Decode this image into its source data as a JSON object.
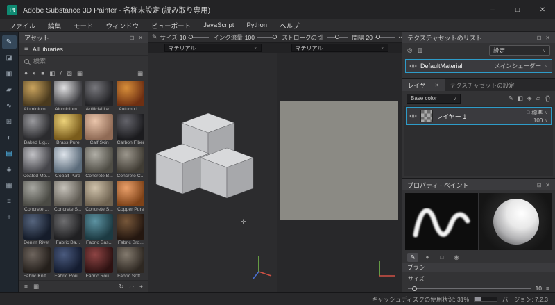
{
  "colors": {
    "accent": "#2e9cc9",
    "app_badge_bg": "#0f8a72"
  },
  "icons": {
    "chevron": "∨",
    "hamburger": "≡",
    "float": "⊡",
    "close": "✕",
    "refresh": "↻",
    "folder": "▱",
    "plus": "+",
    "grid": "▦",
    "columns": "▥",
    "pencil": "✎",
    "sq_outline": "□",
    "target": "◎",
    "cursor": "✛"
  },
  "titlebar": {
    "app_badge": "Pt",
    "title": "Adobe Substance 3D Painter - 名称未設定 (読み取り専用)",
    "minimize": "–",
    "maximize": "□",
    "close": "✕"
  },
  "menubar": {
    "items": [
      "ファイル",
      "編集",
      "モード",
      "ウィンドウ",
      "ビューポート",
      "JavaScript",
      "Python",
      "ヘルプ"
    ]
  },
  "toolbar": {
    "groups": [
      {
        "label": "サイズ",
        "value": "10",
        "pos": "12%"
      },
      {
        "label": "インク流量",
        "value": "100",
        "pos": "86%"
      },
      {
        "label": "ストロークの引",
        "value": "",
        "pos": "50%"
      },
      {
        "label": "間隔",
        "value": "20",
        "pos": "18%"
      }
    ],
    "right_icons": [
      {
        "name": "stroke-dots-icon",
        "glyph": "⋯"
      },
      {
        "name": "pen-settings-icon",
        "glyph": "✎"
      }
    ]
  },
  "toolstrip": {
    "tools": [
      {
        "name": "paint-tool-icon",
        "glyph": "✎",
        "selected": true
      },
      {
        "name": "eraser-tool-icon",
        "glyph": "◪"
      },
      {
        "name": "projection-tool-icon",
        "glyph": "▣"
      },
      {
        "name": "polygon-fill-tool-icon",
        "glyph": "▰"
      },
      {
        "name": "smudge-tool-icon",
        "glyph": "∿"
      },
      {
        "name": "clone-tool-icon",
        "glyph": "⊞"
      },
      {
        "name": "material-picker-tool-icon",
        "glyph": "◐"
      },
      {
        "name": "quick-mask-tool-icon",
        "glyph": "▤",
        "accent": true
      },
      {
        "name": "symmetry-tool-icon",
        "glyph": "◈"
      },
      {
        "name": "grid-tool-icon",
        "glyph": "▦"
      },
      {
        "name": "view-settings-tool-icon",
        "glyph": "≡"
      },
      {
        "name": "add-tool-icon",
        "glyph": "+"
      }
    ]
  },
  "assets": {
    "title": "アセット",
    "library_label": "All libraries",
    "search_placeholder": "検索",
    "filters": [
      {
        "name": "filter-materials-icon",
        "glyph": "●"
      },
      {
        "name": "filter-smart-materials-icon",
        "glyph": "◐"
      },
      {
        "name": "filter-smart-masks-icon",
        "glyph": "■"
      },
      {
        "name": "filter-filters-icon",
        "glyph": "◧"
      },
      {
        "name": "filter-brushes-icon",
        "glyph": "/"
      },
      {
        "name": "filter-alphas-icon",
        "glyph": "▨"
      },
      {
        "name": "filter-textures-icon",
        "glyph": "▦"
      }
    ],
    "footer_left": [
      {
        "name": "list-view-icon",
        "glyph": "≡"
      },
      {
        "name": "thumbnail-view-icon",
        "glyph": "▦"
      }
    ],
    "footer_right": [
      {
        "name": "refresh-assets-icon",
        "glyph": "↻"
      },
      {
        "name": "import-resources-icon",
        "glyph": "▱"
      },
      {
        "name": "add-resource-icon",
        "glyph": "+"
      }
    ],
    "materials": [
      {
        "name": "Aluminium...",
        "c1": "#caa45e",
        "c2": "#4a3a1e"
      },
      {
        "name": "Aluminium...",
        "c1": "#e0e0e2",
        "c2": "#3c3c40"
      },
      {
        "name": "Artificial Le...",
        "c1": "#77777c",
        "c2": "#232326"
      },
      {
        "name": "Autumn L...",
        "c1": "#d88f3a",
        "c2": "#6e2f12"
      },
      {
        "name": "Baked Lig...",
        "c1": "#9a9a9e",
        "c2": "#2b2b2e"
      },
      {
        "name": "Brass Pure",
        "c1": "#ecd27a",
        "c2": "#7a5c1c"
      },
      {
        "name": "Calf Skin",
        "c1": "#eac5ab",
        "c2": "#8f6a55"
      },
      {
        "name": "Carbon Fiber",
        "c1": "#63636a",
        "c2": "#1b1b1e"
      },
      {
        "name": "Coated Me...",
        "c1": "#c2c2c6",
        "c2": "#45454a"
      },
      {
        "name": "Cobalt Pure",
        "c1": "#dde3ea",
        "c2": "#5b6b7a"
      },
      {
        "name": "Concrete B...",
        "c1": "#b0aea6",
        "c2": "#4e4c44"
      },
      {
        "name": "Concrete C...",
        "c1": "#9b968c",
        "c2": "#403c34"
      },
      {
        "name": "Concrete ...",
        "c1": "#a8a8a2",
        "c2": "#4a4a44"
      },
      {
        "name": "Concrete S...",
        "c1": "#c6c2ba",
        "c2": "#5e5a52"
      },
      {
        "name": "Concrete S...",
        "c1": "#cfc2ab",
        "c2": "#6e6250"
      },
      {
        "name": "Copper Pure",
        "c1": "#eba06a",
        "c2": "#7e4218"
      },
      {
        "name": "Denim Rivet",
        "c1": "#56657e",
        "c2": "#151c2a"
      },
      {
        "name": "Fabric Ba...",
        "c1": "#6e6e70",
        "c2": "#202022"
      },
      {
        "name": "Fabric Bas...",
        "c1": "#5d93a2",
        "c2": "#1c3a42"
      },
      {
        "name": "Fabric Bro...",
        "c1": "#77573a",
        "c2": "#241710"
      },
      {
        "name": "Fabric Knit...",
        "c1": "#6e655e",
        "c2": "#241f1b"
      },
      {
        "name": "Fabric Rou...",
        "c1": "#4a5a7e",
        "c2": "#141c30"
      },
      {
        "name": "Fabric Rou...",
        "c1": "#8e4444",
        "c2": "#2e1212"
      },
      {
        "name": "Fabric Soft...",
        "c1": "#837a6e",
        "c2": "#2e2822"
      }
    ]
  },
  "viewport3d": {
    "selector": "マテリアル"
  },
  "viewport2d": {
    "selector": "マテリアル"
  },
  "texture_sets": {
    "title": "テクスチャセットのリスト",
    "settings_label": "設定",
    "set_name": "DefaultMaterial",
    "shader_label": "メインシェーダー"
  },
  "layers": {
    "tab_layers": "レイヤー",
    "tab_settings": "テクスチャセットの設定",
    "channel_label": "Base color",
    "toolbar_icons": [
      {
        "name": "add-mask-icon",
        "glyph": "✎"
      },
      {
        "name": "add-fill-layer-icon",
        "glyph": "◧"
      },
      {
        "name": "add-smart-material-icon",
        "glyph": "◈"
      },
      {
        "name": "add-folder-icon",
        "glyph": "▱"
      }
    ],
    "layer": {
      "name": "レイヤー 1",
      "blend": "標準",
      "opacity": "100"
    }
  },
  "properties": {
    "title": "プロパティ - ペイント",
    "tabs": [
      {
        "name": "brush-tab-icon",
        "glyph": "✎",
        "selected": true
      },
      {
        "name": "alpha-tab-icon",
        "glyph": "●"
      },
      {
        "name": "stencil-tab-icon",
        "glyph": "□"
      },
      {
        "name": "material-tab-icon",
        "glyph": "◉"
      }
    ],
    "brush_section": "ブラシ",
    "size_label": "サイズ",
    "size_value": "10"
  },
  "statusbar": {
    "cache_label": "キャッシュディスクの使用状況: 31%",
    "cache_percent": 31,
    "version_label": "バージョン: 7.2.3"
  }
}
